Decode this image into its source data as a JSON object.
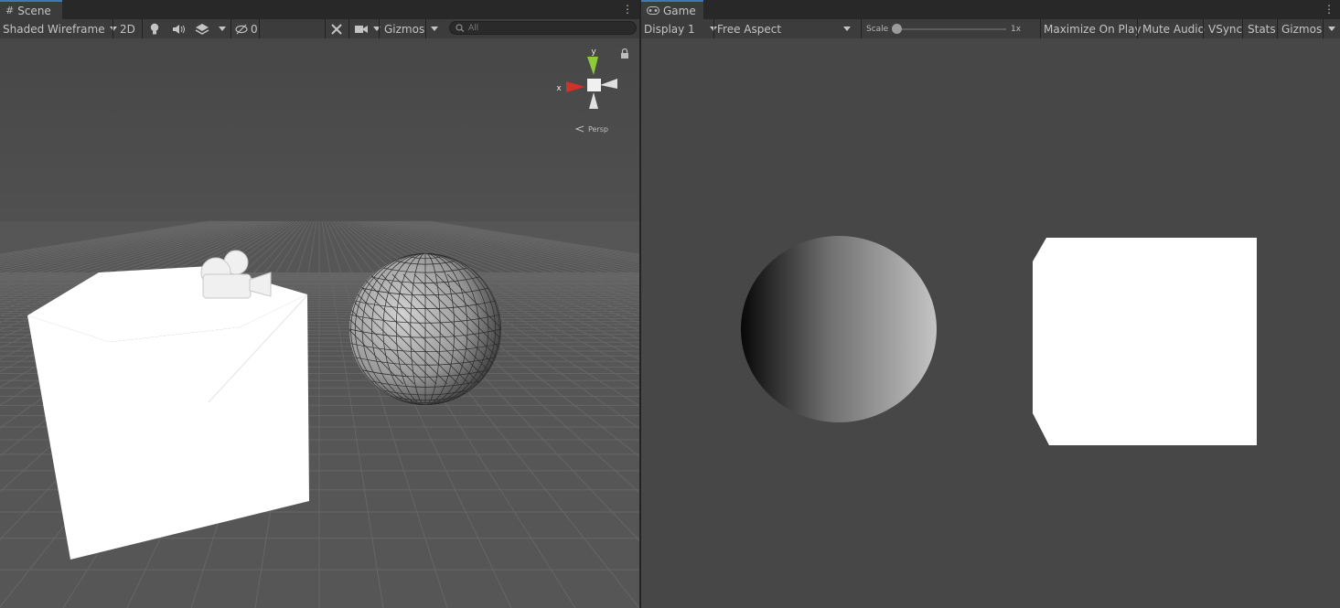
{
  "scene_tab": {
    "label": "Scene",
    "icon": "grid-icon"
  },
  "game_tab": {
    "label": "Game",
    "icon": "gamepad-icon"
  },
  "scene_toolbar": {
    "draw_mode": "Shaded Wireframe",
    "toggle_2d": "2D",
    "hidden_count": "0",
    "gizmos": "Gizmos",
    "search_placeholder": "All"
  },
  "scene_gizmo": {
    "y_label": "y",
    "x_label": "x",
    "projection": "Persp"
  },
  "game_toolbar": {
    "display": "Display 1",
    "aspect": "Free Aspect",
    "scale_label": "Scale",
    "scale_value": "1x",
    "scale_fraction": 0.0,
    "maximize": "Maximize On Play",
    "mute": "Mute Audio",
    "vsync": "VSync",
    "stats": "Stats",
    "gizmos": "Gizmos"
  },
  "colors": {
    "tab_accent": "#3a79bb",
    "x_axis": "#d0322a",
    "y_axis": "#8ccb3a",
    "viewport_bg": "#474747"
  }
}
